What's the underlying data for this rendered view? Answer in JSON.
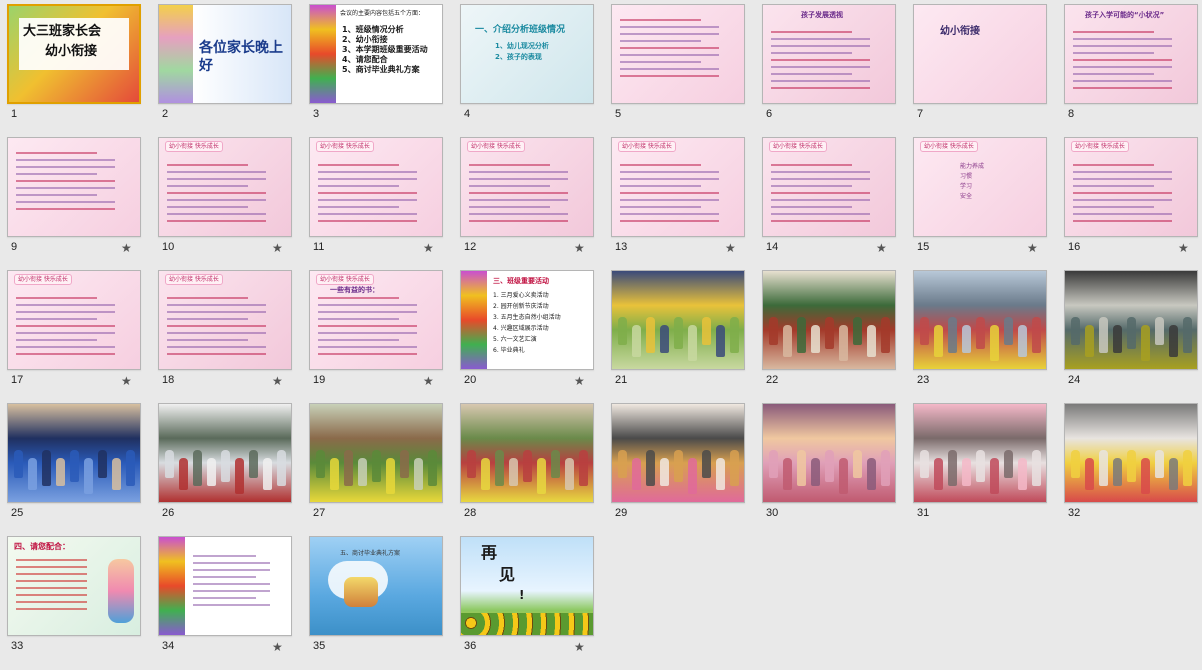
{
  "slides": [
    {
      "number": "1",
      "title_lines": [
        "大三班家长会",
        "幼小衔接"
      ],
      "theme": "cover",
      "selected": true,
      "star": false
    },
    {
      "number": "2",
      "banner": "各位家长晚上好",
      "theme": "banner",
      "star": false
    },
    {
      "number": "3",
      "intro": "会议的主要内容包括五个方面：",
      "items": [
        "1、班级情况分析",
        "2、幼小衔接",
        "3、本学期班级重要活动",
        "4、请您配合",
        "5、商讨毕业典礼方案"
      ],
      "theme": "list",
      "star": false
    },
    {
      "number": "4",
      "heading": "一、介绍分析班级情况",
      "sub_items": [
        "1、幼儿现况分析",
        "2、孩子的表现"
      ],
      "theme": "teal",
      "star": false
    },
    {
      "number": "5",
      "theme": "pink-text",
      "star": false
    },
    {
      "number": "6",
      "heading": "孩子发展透视",
      "theme": "pink-lines",
      "star": false
    },
    {
      "number": "7",
      "heading": "幼小衔接",
      "theme": "pink-title",
      "star": false
    },
    {
      "number": "8",
      "heading": "孩子入学可能的“小状况”",
      "theme": "pink-text",
      "star": false
    },
    {
      "number": "9",
      "theme": "pink-text",
      "star": true
    },
    {
      "number": "10",
      "header": "幼小衔接 快乐成长",
      "theme": "pink-text",
      "star": true
    },
    {
      "number": "11",
      "header": "幼小衔接 快乐成长",
      "theme": "pink-text",
      "star": true
    },
    {
      "number": "12",
      "header": "幼小衔接 快乐成长",
      "theme": "pink-text",
      "star": true
    },
    {
      "number": "13",
      "header": "幼小衔接 快乐成长",
      "theme": "pink-text",
      "star": true
    },
    {
      "number": "14",
      "header": "幼小衔接 快乐成长",
      "theme": "pink-text",
      "star": true
    },
    {
      "number": "15",
      "header": "幼小衔接 快乐成长",
      "items": [
        "能力养成",
        "习惯",
        "学习",
        "安全"
      ],
      "theme": "pink-text",
      "star": true
    },
    {
      "number": "16",
      "header": "幼小衔接 快乐成长",
      "theme": "pink-text",
      "star": true
    },
    {
      "number": "17",
      "header": "幼小衔接 快乐成长",
      "theme": "pink-text",
      "star": true
    },
    {
      "number": "18",
      "header": "幼小衔接 快乐成长",
      "theme": "pink-text",
      "star": true
    },
    {
      "number": "19",
      "header": "幼小衔接 快乐成长",
      "heading": "一些有益的书：",
      "theme": "pink-text",
      "star": true
    },
    {
      "number": "20",
      "heading": "三、班级重要活动",
      "items": [
        "1. 三月爱心义卖活动",
        "2. 园开创新节庆活动",
        "3. 五月生态自然小组活动",
        "4. 兴趣区域展示活动",
        "5. 六一文艺汇演",
        "6. 毕业典礼"
      ],
      "theme": "list2",
      "star": true
    },
    {
      "number": "21",
      "theme": "photo-a",
      "star": false
    },
    {
      "number": "22",
      "theme": "photo-b",
      "star": false
    },
    {
      "number": "23",
      "theme": "photo-c",
      "star": false
    },
    {
      "number": "24",
      "theme": "photo-d",
      "star": false
    },
    {
      "number": "25",
      "theme": "photo-e",
      "star": false
    },
    {
      "number": "26",
      "theme": "photo-f",
      "star": false
    },
    {
      "number": "27",
      "theme": "photo-g",
      "star": false
    },
    {
      "number": "28",
      "theme": "photo-h",
      "star": false
    },
    {
      "number": "29",
      "theme": "photo-i",
      "star": false
    },
    {
      "number": "30",
      "theme": "photo-j",
      "star": false
    },
    {
      "number": "31",
      "theme": "photo-k",
      "star": false
    },
    {
      "number": "32",
      "theme": "photo-l",
      "star": false
    },
    {
      "number": "33",
      "heading": "四、请您配合：",
      "theme": "pink-cartoon",
      "star": false
    },
    {
      "number": "34",
      "theme": "list3",
      "star": true
    },
    {
      "number": "35",
      "heading": "五、商讨毕业典礼方案",
      "theme": "sky",
      "star": false
    },
    {
      "number": "36",
      "lines": [
        "再",
        "见",
        "!"
      ],
      "theme": "bye",
      "star": true
    }
  ],
  "star_glyph": "★"
}
